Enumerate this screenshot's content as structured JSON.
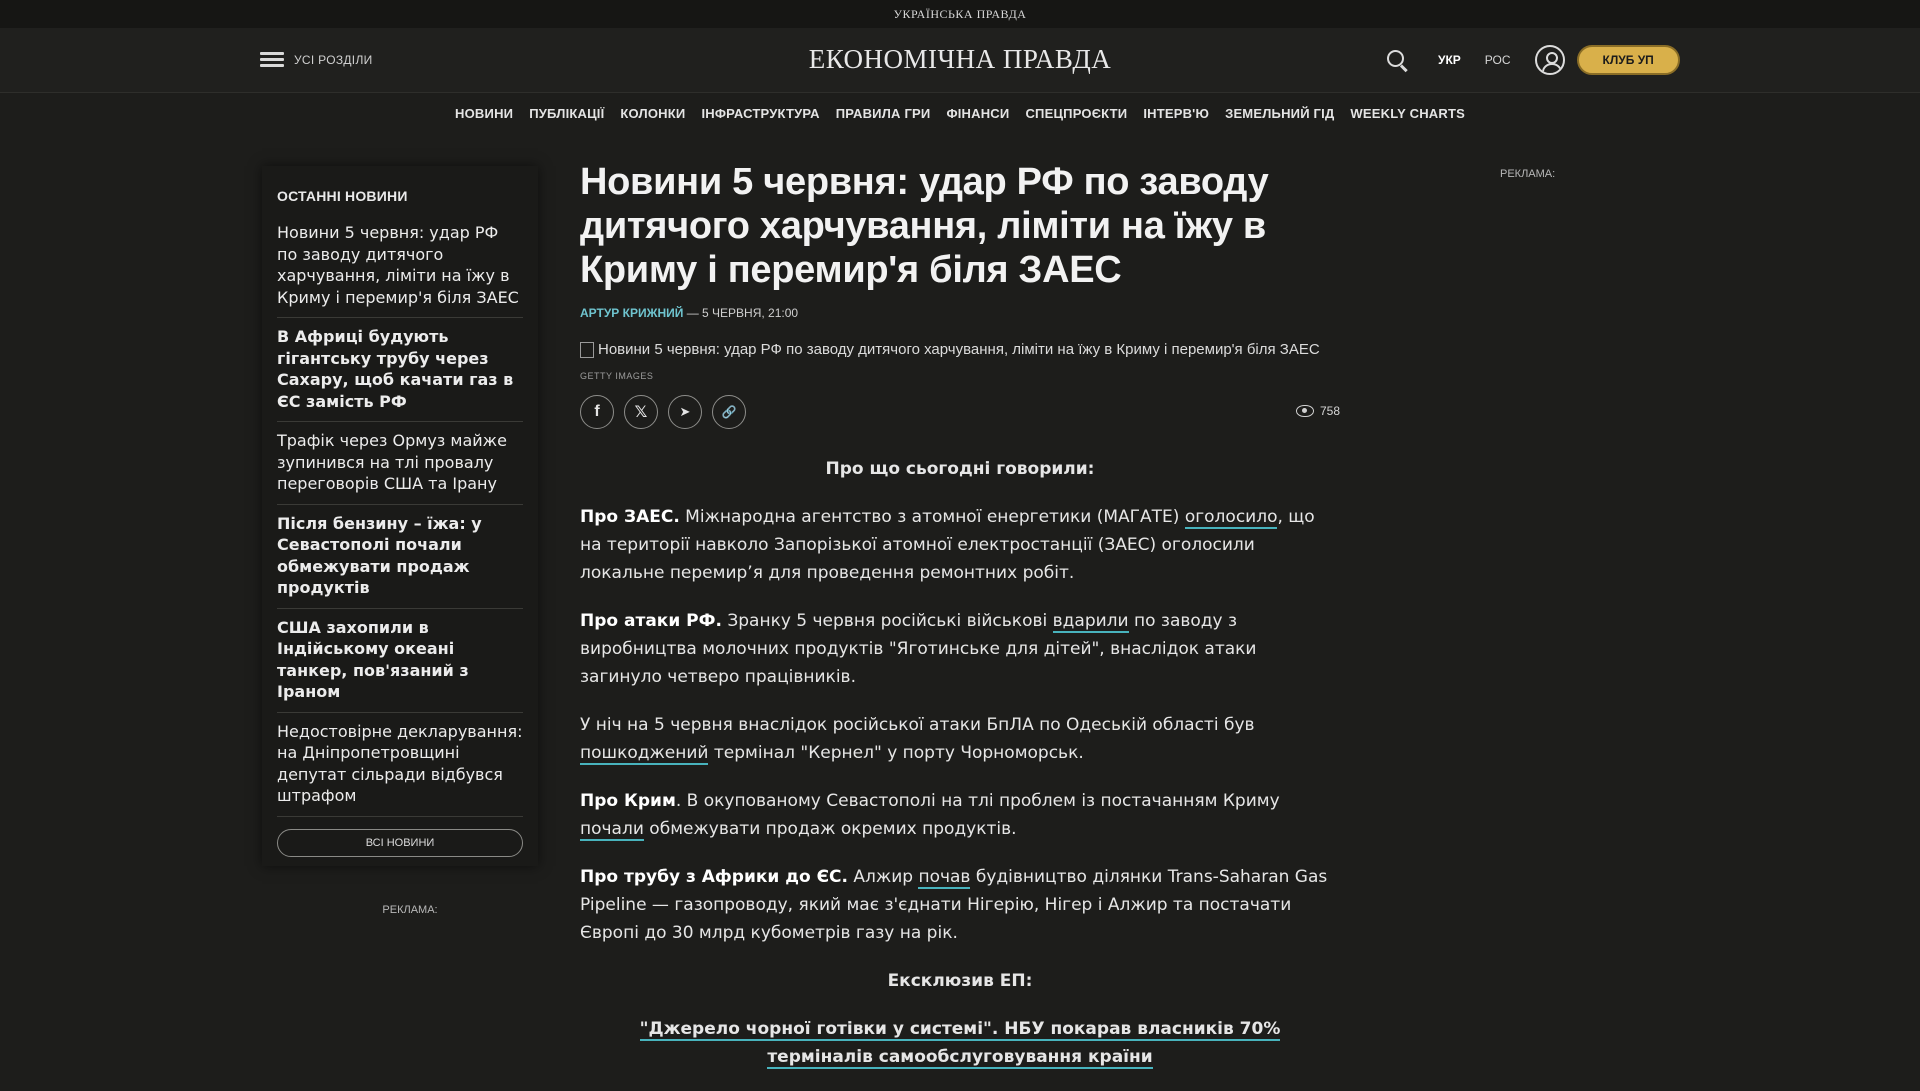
{
  "topbar": {
    "brand": "УКРАЇНСЬКА ПРАВДА"
  },
  "header": {
    "menu_label": "УСІ РОЗДІЛИ",
    "logo": "ЕКОНОМІЧНА ПРАВДА",
    "lang_ukr": "УКР",
    "lang_ros": "РОС",
    "club_label": "КЛУБ УП",
    "icons": [
      "menu-icon",
      "search-icon",
      "user-icon"
    ]
  },
  "nav": {
    "items": [
      "НОВИНИ",
      "ПУБЛІКАЦІЇ",
      "КОЛОНКИ",
      "ІНФРАСТРУКТУРА",
      "ПРАВИЛА ГРИ",
      "ФІНАНСИ",
      "СПЕЦПРОЄКТИ",
      "ІНТЕРВ'Ю",
      "ЗЕМЕЛЬНИЙ ГІД",
      "WEEKLY CHARTS"
    ]
  },
  "sidebar": {
    "title": "ОСТАННІ НОВИНИ",
    "items": [
      "Новини 5 червня: удар РФ по заводу дитячого харчування, ліміти на їжу в Криму і перемир'я біля ЗАЕС",
      "В Африці будують гігантську трубу через Сахару, щоб качати газ в ЄС замість РФ",
      "Трафік через Ормуз майже зупинився на тлі провалу переговорів США та Ірану",
      "Після бензину – їжа: у Севастополі почали обмежувати продаж продуктів",
      "США захопили в Індійському океані танкер, пов'язаний з Іраном",
      "Недостовірне декларування: на Дніпропетровщині депутат сільради відбувся штрафом"
    ],
    "all_news": "ВСІ НОВИНИ",
    "ad_label": "РЕКЛАМА:"
  },
  "ad_right": "РЕКЛАМА:",
  "article": {
    "title": "Новини 5 червня: удар РФ по заводу дитячого харчування, ліміти на їжу в Криму і перемир'я біля ЗАЕС",
    "author": "АРТУР КРИЖНИЙ",
    "date": " — 5 ЧЕРВНЯ, 21:00",
    "image_alt": "Новини 5 червня: удар РФ по заводу дитячого харчування, ліміти на їжу в Криму і перемир'я біля ЗАЕС",
    "image_credit": "GETTY IMAGES",
    "share": {
      "facebook": "f",
      "x": "𝕏",
      "telegram": "➤",
      "copy": "🔗"
    },
    "views": "758",
    "intro": "Про що сьогодні говорили:",
    "p1": {
      "lead": "Про ЗАЕС.",
      "t1": " Міжнародна агентство з атомної енергетики (МАГАТЕ) ",
      "link": "оголосило",
      "t2": ", що на території навколо Запорізької атомної електростанції (ЗАЕС) оголосили локальне перемир’я для проведення ремонтних робіт."
    },
    "p2": {
      "lead": "Про атаки РФ.",
      "t1": " Зранку 5 червня російські військові ",
      "link": "вдарили",
      "t2": " по заводу з виробництва молочних продуктів \"Яготинське для дітей\", внаслідок атаки загинуло четверо працівників."
    },
    "p3": {
      "t1": "У ніч на 5 червня внаслідок російської атаки БпЛА по Одеській області був ",
      "link": "пошкоджений",
      "t2": " термінал \"Кернел\" у порту Чорноморськ."
    },
    "p4": {
      "lead": "Про Крим",
      "t1": ". В окупованому Севастополі на тлі проблем із постачанням Криму ",
      "link": "почали",
      "t2": " обмежувати продаж окремих продуктів."
    },
    "p5": {
      "lead": "Про трубу з Африки до ЄС.",
      "t1": " Алжир ",
      "link": "почав",
      "t2": " будівництво ділянки Trans-Saharan Gas Pipeline — газопроводу, який має з'єднати Нігерію, Нігер і Алжир та постачати Європі до 30 млрд кубометрів газу на рік."
    },
    "exclusive_title": "Ексклюзив ЕП:",
    "exclusive_link": "\"Джерело чорної готівки у системі\". НБУ покарав власників 70% терміналів самообслуговування країни"
  },
  "colors": {
    "background": "#1d1d1b",
    "accent": "#48b3bd",
    "club": "#d9b04a"
  }
}
